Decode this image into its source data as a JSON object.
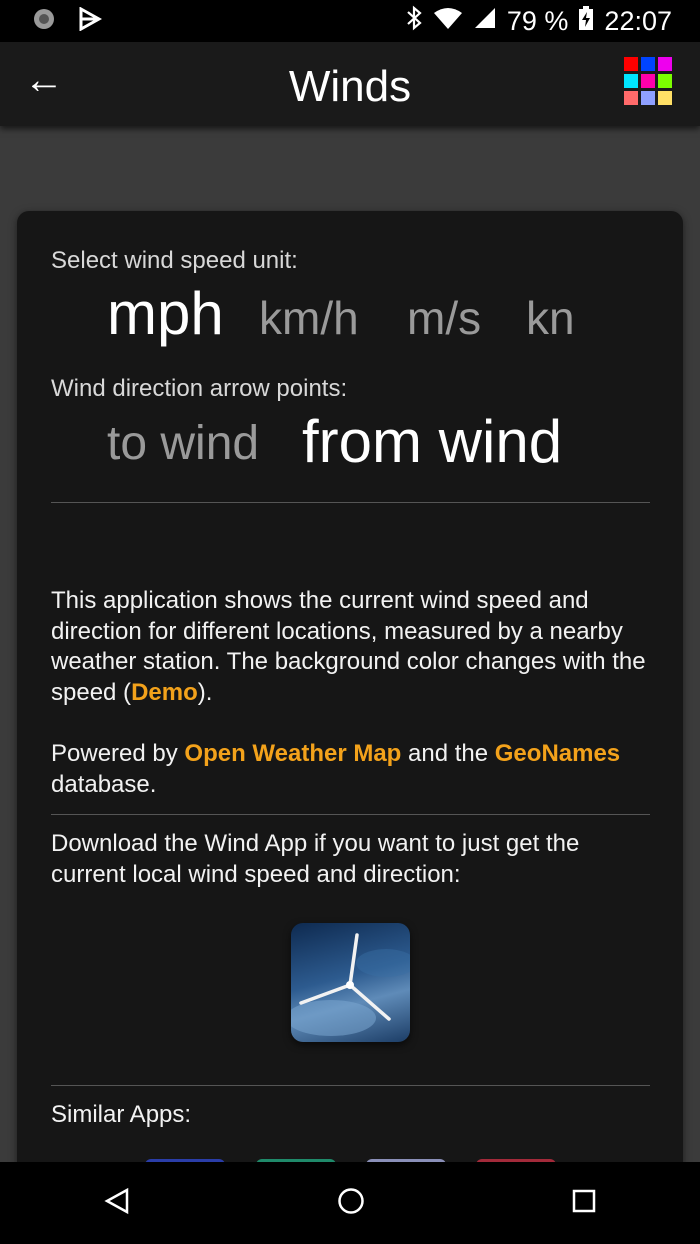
{
  "status_bar": {
    "battery": "79 %",
    "time": "22:07"
  },
  "app_bar": {
    "back": "←",
    "title": "Winds",
    "grid_colors": [
      "#ff0000",
      "#0044ff",
      "#ee00ee",
      "#00e5ff",
      "#ff00aa",
      "#7cff00",
      "#ff6a6a",
      "#8fa0ff",
      "#ffe066"
    ]
  },
  "settings": {
    "speed_label": "Select wind speed unit:",
    "units": [
      "mph",
      "km/h",
      "m/s",
      "kn"
    ],
    "selected_unit": "mph",
    "direction_label": "Wind direction arrow points:",
    "directions": [
      "to wind",
      "from wind"
    ],
    "selected_direction": "from wind"
  },
  "about": {
    "p1_text": "This application shows the current wind speed and direction for different locations, measured by a nearby weather station. The background color changes with the speed (",
    "p1_link": "Demo",
    "p1_end": ").",
    "p2_prefix": "Powered by ",
    "p2_link1": "Open Weather Map",
    "p2_mid": " and the ",
    "p2_link2": "GeoNames",
    "p2_end": " database."
  },
  "download": {
    "text": "Download the Wind App if you want to just get the current local wind speed and direction:"
  },
  "similar": {
    "label": "Similar Apps:"
  },
  "colors": {
    "link": "#f3a21b",
    "card_bg": "#161616",
    "background": "#3b3b3b"
  }
}
